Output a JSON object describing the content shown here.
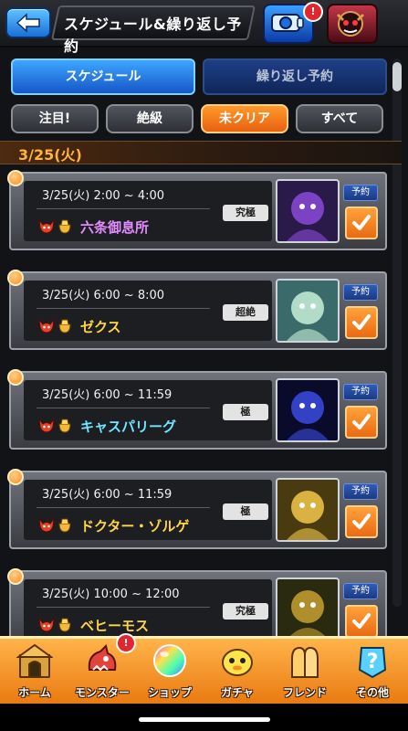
{
  "header": {
    "title": "スケジュール&繰り返し予約",
    "top_badge": "!"
  },
  "tabs": [
    {
      "label": "スケジュール",
      "active": true
    },
    {
      "label": "繰り返し予約",
      "active": false
    }
  ],
  "filters": [
    {
      "label": "注目!",
      "active": false
    },
    {
      "label": "絶級",
      "active": false
    },
    {
      "label": "未クリア",
      "active": true
    },
    {
      "label": "すべて",
      "active": false
    }
  ],
  "date_header": "3/25(火)",
  "quests": [
    {
      "time": "3/25(火) 2:00 ~ 4:00",
      "difficulty": "究極",
      "name": "六条御息所",
      "reserve_label": "予約",
      "reserved": true,
      "name_color": "#e48cff"
    },
    {
      "time": "3/25(火) 6:00 ~ 8:00",
      "difficulty": "超絶",
      "name": "ゼクス",
      "reserve_label": "予約",
      "reserved": true,
      "name_color": "#ffd54a"
    },
    {
      "time": "3/25(火) 6:00 ~ 11:59",
      "difficulty": "極",
      "name": "キャスパリーグ",
      "reserve_label": "予約",
      "reserved": true,
      "name_color": "#6fe6ff"
    },
    {
      "time": "3/25(火) 6:00 ~ 11:59",
      "difficulty": "極",
      "name": "ドクター・ゾルゲ",
      "reserve_label": "予約",
      "reserved": true,
      "name_color": "#ffd54a"
    },
    {
      "time": "3/25(火) 10:00 ~ 12:00",
      "difficulty": "究極",
      "name": "ベヒーモス",
      "reserve_label": "予約",
      "reserved": true,
      "name_color": "#ffd54a"
    }
  ],
  "bottom_nav": [
    {
      "label": "ホーム",
      "icon": "home-icon"
    },
    {
      "label": "モンスター",
      "icon": "monster-icon",
      "badge": "!"
    },
    {
      "label": "ショップ",
      "icon": "shop-orb-icon"
    },
    {
      "label": "ガチャ",
      "icon": "gacha-icon"
    },
    {
      "label": "フレンド",
      "icon": "friend-icon"
    },
    {
      "label": "その他",
      "icon": "other-icon"
    }
  ]
}
